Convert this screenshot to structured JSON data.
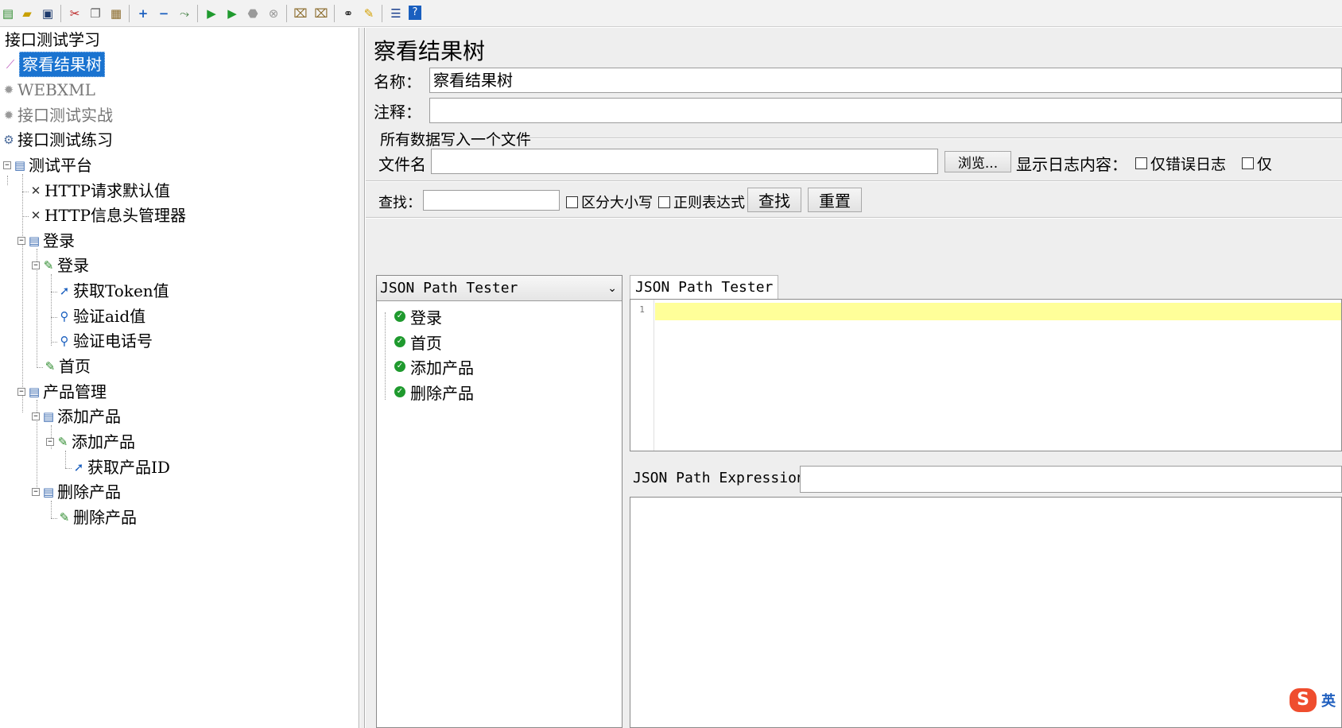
{
  "toolbar": {
    "icons": [
      "new-icon",
      "open-icon",
      "save-icon",
      "cut-icon",
      "copy-icon",
      "paste-icon",
      "expand-icon",
      "collapse-icon",
      "toggle-icon",
      "start-icon",
      "start-no-pause-icon",
      "stop-icon",
      "shutdown-icon",
      "clear-icon",
      "clear-all-icon",
      "search-icon",
      "reset-search-icon",
      "function-helper-icon",
      "help-icon"
    ]
  },
  "tree": {
    "items": [
      {
        "label": "接口测试学习"
      },
      {
        "label": "察看结果树"
      },
      {
        "label": "WEBXML"
      },
      {
        "label": "接口测试实战"
      },
      {
        "label": "接口测试练习"
      },
      {
        "label": "测试平台"
      },
      {
        "label": "HTTP请求默认值"
      },
      {
        "label": "HTTP信息头管理器"
      },
      {
        "label": "登录"
      },
      {
        "label": "登录"
      },
      {
        "label": "获取Token值"
      },
      {
        "label": "验证aid值"
      },
      {
        "label": "验证电话号"
      },
      {
        "label": "首页"
      },
      {
        "label": "产品管理"
      },
      {
        "label": "添加产品"
      },
      {
        "label": "添加产品"
      },
      {
        "label": "获取产品ID"
      },
      {
        "label": "删除产品"
      },
      {
        "label": "删除产品"
      }
    ]
  },
  "panel": {
    "title": "察看结果树",
    "name_label": "名称：",
    "name_value": "察看结果树",
    "comment_label": "注释：",
    "comment_value": "",
    "file_section": "所有数据写入一个文件",
    "filename_label": "文件名",
    "filename_value": "",
    "browse_label": "浏览...",
    "log_content_label": "显示日志内容：",
    "errors_only_label": "仅错误日志",
    "success_only_label": "仅"
  },
  "search": {
    "label": "查找：",
    "value": "",
    "case_label": "区分大小写",
    "regex_label": "正则表达式",
    "find_button": "查找",
    "reset_button": "重置"
  },
  "results": {
    "renderer": "JSON Path Tester",
    "renderer_caret": "⌄",
    "samples": [
      {
        "label": "登录",
        "status": "success"
      },
      {
        "label": "首页",
        "status": "success"
      },
      {
        "label": "添加产品",
        "status": "success"
      },
      {
        "label": "删除产品",
        "status": "success"
      }
    ]
  },
  "tester": {
    "tab_label": "JSON Path Tester",
    "line_number": "1",
    "expression_label": "JSON Path Expression",
    "expression_value": ""
  },
  "ime": {
    "logo": "S",
    "mode": "英"
  },
  "colors": {
    "selection": "#1a73d0",
    "success": "#1f9a2e",
    "editor_highlight": "#ffff99",
    "ime_brand": "#ef4d2e"
  }
}
